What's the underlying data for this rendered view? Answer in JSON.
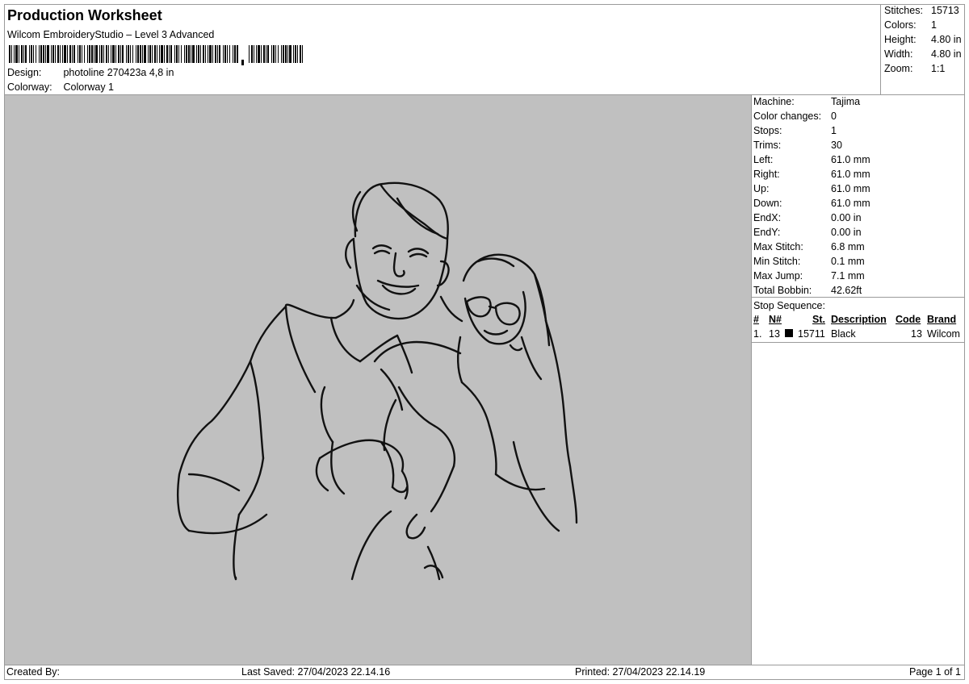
{
  "header": {
    "title": "Production Worksheet",
    "subtitle": "Wilcom EmbroideryStudio – Level 3 Advanced",
    "design_label": "Design:",
    "design_value": "photoline 270423a 4,8 in",
    "colorway_label": "Colorway:",
    "colorway_value": "Colorway 1"
  },
  "stats": [
    {
      "label": "Stitches:",
      "value": "15713"
    },
    {
      "label": "Colors:",
      "value": "1"
    },
    {
      "label": "Height:",
      "value": "4.80 in"
    },
    {
      "label": "Width:",
      "value": "4.80 in"
    },
    {
      "label": "Zoom:",
      "value": "1:1"
    }
  ],
  "machine_info": [
    {
      "label": "Machine:",
      "value": "Tajima"
    },
    {
      "label": "Color changes:",
      "value": "0"
    },
    {
      "label": "Stops:",
      "value": "1"
    },
    {
      "label": "Trims:",
      "value": "30"
    },
    {
      "label": "Left:",
      "value": "61.0 mm"
    },
    {
      "label": "Right:",
      "value": "61.0 mm"
    },
    {
      "label": "Up:",
      "value": "61.0 mm"
    },
    {
      "label": "Down:",
      "value": "61.0 mm"
    },
    {
      "label": "EndX:",
      "value": "0.00 in"
    },
    {
      "label": "EndY:",
      "value": "0.00 in"
    },
    {
      "label": "Max Stitch:",
      "value": "6.8 mm"
    },
    {
      "label": "Min Stitch:",
      "value": "0.1 mm"
    },
    {
      "label": "Max Jump:",
      "value": "7.1 mm"
    },
    {
      "label": "Total Bobbin:",
      "value": "42.62ft"
    }
  ],
  "stop_sequence": {
    "title": "Stop Sequence:",
    "headers": {
      "num": "#",
      "needle": "N#",
      "stitches": "St.",
      "description": "Description",
      "code": "Code",
      "brand": "Brand"
    },
    "rows": [
      {
        "num": "1.",
        "needle": "13",
        "swatch_color": "#000000",
        "stitches": "15711",
        "description": "Black",
        "code": "13",
        "brand": "Wilcom"
      }
    ]
  },
  "footer": {
    "created_by": "Created By:",
    "last_saved": "Last Saved: 27/04/2023 22.14.16",
    "printed": "Printed: 27/04/2023 22.14.19",
    "page": "Page 1 of 1"
  },
  "colors": {
    "canvas_bg": "#c0c0c0",
    "thread": "#111111"
  }
}
